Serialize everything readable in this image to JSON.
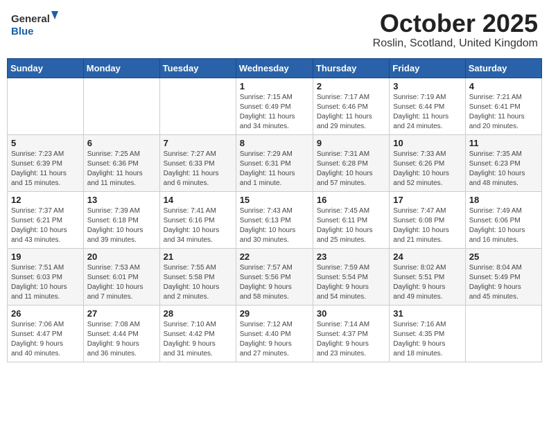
{
  "header": {
    "logo_line1": "General",
    "logo_line2": "Blue",
    "month": "October 2025",
    "location": "Roslin, Scotland, United Kingdom"
  },
  "weekdays": [
    "Sunday",
    "Monday",
    "Tuesday",
    "Wednesday",
    "Thursday",
    "Friday",
    "Saturday"
  ],
  "weeks": [
    [
      {
        "day": "",
        "info": ""
      },
      {
        "day": "",
        "info": ""
      },
      {
        "day": "",
        "info": ""
      },
      {
        "day": "1",
        "info": "Sunrise: 7:15 AM\nSunset: 6:49 PM\nDaylight: 11 hours\nand 34 minutes."
      },
      {
        "day": "2",
        "info": "Sunrise: 7:17 AM\nSunset: 6:46 PM\nDaylight: 11 hours\nand 29 minutes."
      },
      {
        "day": "3",
        "info": "Sunrise: 7:19 AM\nSunset: 6:44 PM\nDaylight: 11 hours\nand 24 minutes."
      },
      {
        "day": "4",
        "info": "Sunrise: 7:21 AM\nSunset: 6:41 PM\nDaylight: 11 hours\nand 20 minutes."
      }
    ],
    [
      {
        "day": "5",
        "info": "Sunrise: 7:23 AM\nSunset: 6:39 PM\nDaylight: 11 hours\nand 15 minutes."
      },
      {
        "day": "6",
        "info": "Sunrise: 7:25 AM\nSunset: 6:36 PM\nDaylight: 11 hours\nand 11 minutes."
      },
      {
        "day": "7",
        "info": "Sunrise: 7:27 AM\nSunset: 6:33 PM\nDaylight: 11 hours\nand 6 minutes."
      },
      {
        "day": "8",
        "info": "Sunrise: 7:29 AM\nSunset: 6:31 PM\nDaylight: 11 hours\nand 1 minute."
      },
      {
        "day": "9",
        "info": "Sunrise: 7:31 AM\nSunset: 6:28 PM\nDaylight: 10 hours\nand 57 minutes."
      },
      {
        "day": "10",
        "info": "Sunrise: 7:33 AM\nSunset: 6:26 PM\nDaylight: 10 hours\nand 52 minutes."
      },
      {
        "day": "11",
        "info": "Sunrise: 7:35 AM\nSunset: 6:23 PM\nDaylight: 10 hours\nand 48 minutes."
      }
    ],
    [
      {
        "day": "12",
        "info": "Sunrise: 7:37 AM\nSunset: 6:21 PM\nDaylight: 10 hours\nand 43 minutes."
      },
      {
        "day": "13",
        "info": "Sunrise: 7:39 AM\nSunset: 6:18 PM\nDaylight: 10 hours\nand 39 minutes."
      },
      {
        "day": "14",
        "info": "Sunrise: 7:41 AM\nSunset: 6:16 PM\nDaylight: 10 hours\nand 34 minutes."
      },
      {
        "day": "15",
        "info": "Sunrise: 7:43 AM\nSunset: 6:13 PM\nDaylight: 10 hours\nand 30 minutes."
      },
      {
        "day": "16",
        "info": "Sunrise: 7:45 AM\nSunset: 6:11 PM\nDaylight: 10 hours\nand 25 minutes."
      },
      {
        "day": "17",
        "info": "Sunrise: 7:47 AM\nSunset: 6:08 PM\nDaylight: 10 hours\nand 21 minutes."
      },
      {
        "day": "18",
        "info": "Sunrise: 7:49 AM\nSunset: 6:06 PM\nDaylight: 10 hours\nand 16 minutes."
      }
    ],
    [
      {
        "day": "19",
        "info": "Sunrise: 7:51 AM\nSunset: 6:03 PM\nDaylight: 10 hours\nand 11 minutes."
      },
      {
        "day": "20",
        "info": "Sunrise: 7:53 AM\nSunset: 6:01 PM\nDaylight: 10 hours\nand 7 minutes."
      },
      {
        "day": "21",
        "info": "Sunrise: 7:55 AM\nSunset: 5:58 PM\nDaylight: 10 hours\nand 2 minutes."
      },
      {
        "day": "22",
        "info": "Sunrise: 7:57 AM\nSunset: 5:56 PM\nDaylight: 9 hours\nand 58 minutes."
      },
      {
        "day": "23",
        "info": "Sunrise: 7:59 AM\nSunset: 5:54 PM\nDaylight: 9 hours\nand 54 minutes."
      },
      {
        "day": "24",
        "info": "Sunrise: 8:02 AM\nSunset: 5:51 PM\nDaylight: 9 hours\nand 49 minutes."
      },
      {
        "day": "25",
        "info": "Sunrise: 8:04 AM\nSunset: 5:49 PM\nDaylight: 9 hours\nand 45 minutes."
      }
    ],
    [
      {
        "day": "26",
        "info": "Sunrise: 7:06 AM\nSunset: 4:47 PM\nDaylight: 9 hours\nand 40 minutes."
      },
      {
        "day": "27",
        "info": "Sunrise: 7:08 AM\nSunset: 4:44 PM\nDaylight: 9 hours\nand 36 minutes."
      },
      {
        "day": "28",
        "info": "Sunrise: 7:10 AM\nSunset: 4:42 PM\nDaylight: 9 hours\nand 31 minutes."
      },
      {
        "day": "29",
        "info": "Sunrise: 7:12 AM\nSunset: 4:40 PM\nDaylight: 9 hours\nand 27 minutes."
      },
      {
        "day": "30",
        "info": "Sunrise: 7:14 AM\nSunset: 4:37 PM\nDaylight: 9 hours\nand 23 minutes."
      },
      {
        "day": "31",
        "info": "Sunrise: 7:16 AM\nSunset: 4:35 PM\nDaylight: 9 hours\nand 18 minutes."
      },
      {
        "day": "",
        "info": ""
      }
    ]
  ]
}
